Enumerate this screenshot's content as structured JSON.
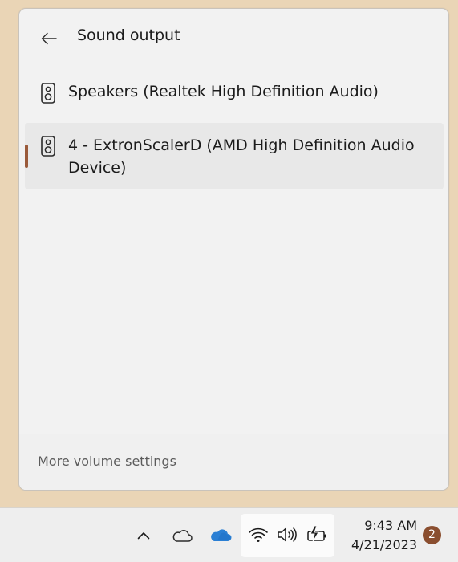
{
  "flyout": {
    "title": "Sound output",
    "devices": [
      {
        "label": "Speakers (Realtek High Definition Audio)",
        "selected": false,
        "icon": "speaker-icon"
      },
      {
        "label": "4 - ExtronScalerD (AMD High Definition Audio Device)",
        "selected": true,
        "icon": "speaker-icon"
      }
    ],
    "more_settings": "More volume settings"
  },
  "taskbar": {
    "icons": [
      "chevron-up-icon",
      "cloud-icon",
      "onedrive-icon",
      "wifi-icon",
      "volume-icon",
      "battery-icon"
    ],
    "time": "9:43 AM",
    "date": "4/21/2023",
    "notification_count": "2"
  },
  "colors": {
    "desktop": "#ead5b6",
    "accent": "#9a5a3a",
    "badge": "#8a4e2f",
    "onedrive": "#2a7fd4"
  }
}
